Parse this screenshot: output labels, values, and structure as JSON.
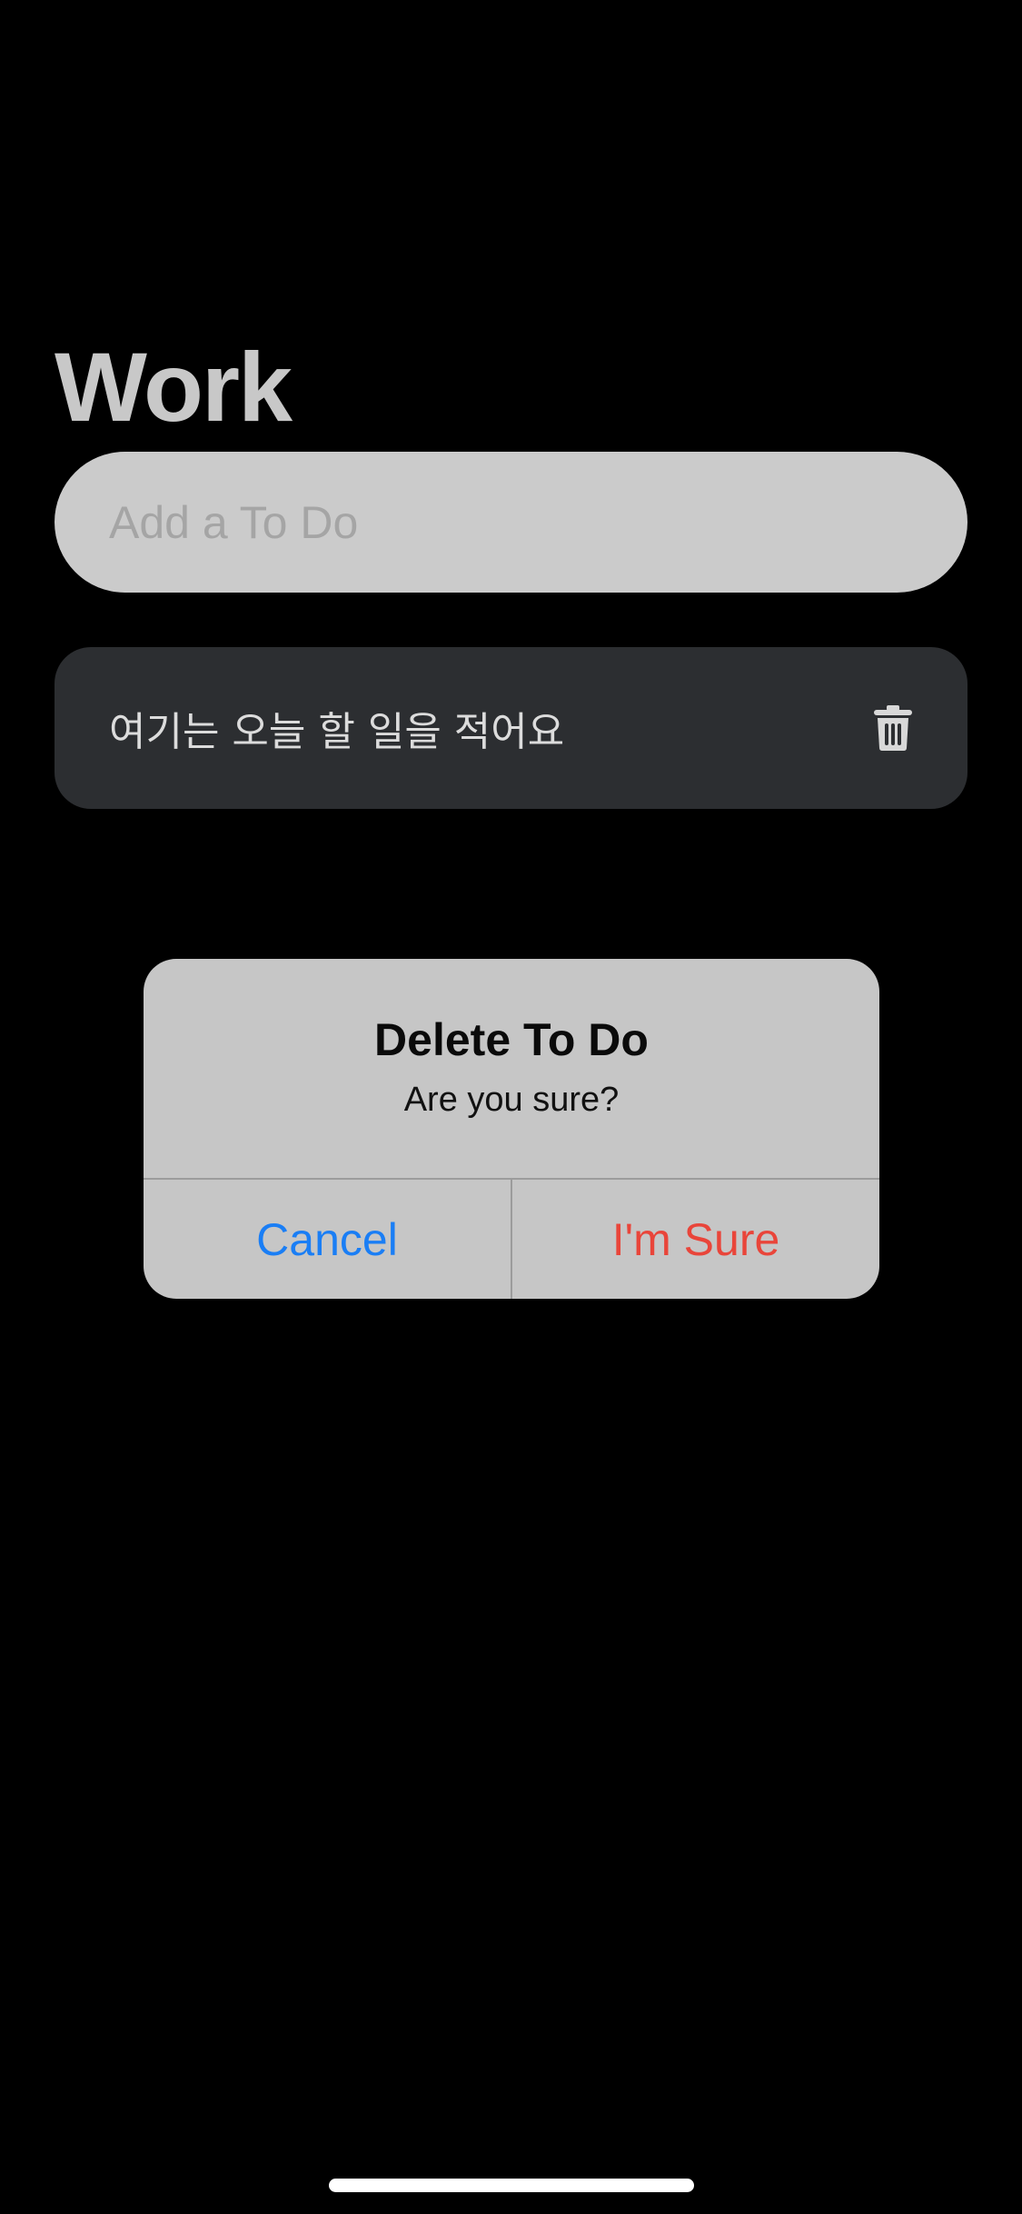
{
  "header": {
    "title": "Work"
  },
  "input": {
    "placeholder": "Add a To Do",
    "value": ""
  },
  "todos": [
    {
      "text": "여기는 오늘 할 일을 적어요",
      "delete_icon": "trash-icon"
    }
  ],
  "alert": {
    "title": "Delete To Do",
    "message": "Are you sure?",
    "cancel_label": "Cancel",
    "confirm_label": "I'm Sure"
  },
  "colors": {
    "background": "#000000",
    "input_background": "#cbcbcb",
    "item_background": "#2c2e31",
    "alert_background": "#c6c6c6",
    "cancel": "#1a7ef5",
    "destructive": "#e9453a"
  }
}
